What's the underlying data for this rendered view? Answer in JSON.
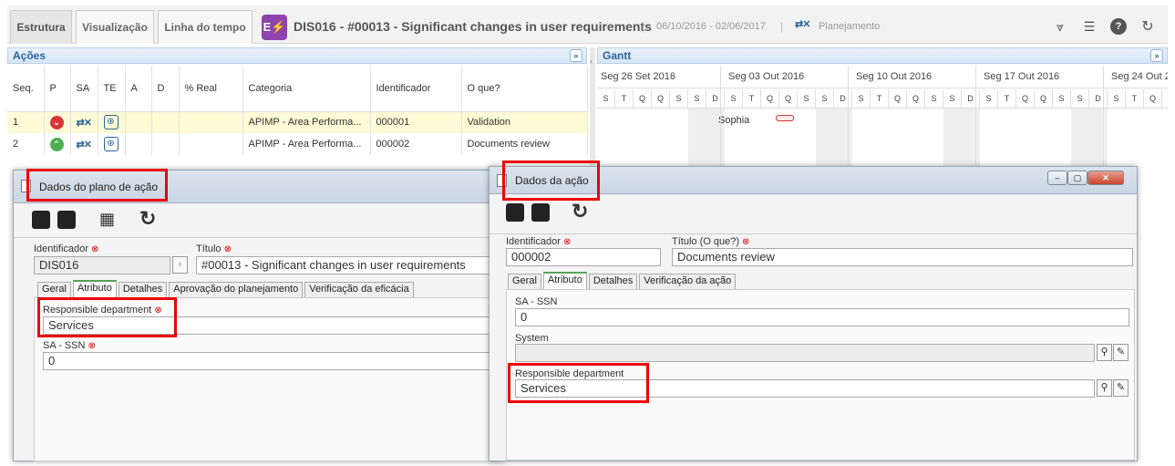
{
  "tabs": [
    {
      "label": "Estrutura"
    },
    {
      "label": "Visualização"
    },
    {
      "label": "Linha do tempo"
    }
  ],
  "header": {
    "title": "DIS016 - #00013 - Significant changes in user requirements",
    "dates": "06/10/2016 - 02/06/2017",
    "status": "Planejamento"
  },
  "actions_panel": {
    "title": "Ações",
    "columns": [
      "Seq.",
      "P",
      "SA",
      "TE",
      "A",
      "D",
      "% Real",
      "Categoria",
      "Identificador",
      "O que?"
    ],
    "rows": [
      {
        "seq": "1",
        "categoria": "APIMP - Area Performa...",
        "identificador": "000001",
        "oque": "Validation",
        "priority": "down",
        "color": "#d9343a"
      },
      {
        "seq": "2",
        "categoria": "APIMP - Area Performa...",
        "identificador": "000002",
        "oque": "Documents review",
        "priority": "up",
        "color": "#4caf50"
      }
    ]
  },
  "gantt": {
    "title": "Gantt",
    "weeks": [
      "Seg 26 Set 2016",
      "Seg 03 Out 2016",
      "Seg 10 Out 2016",
      "Seg 17 Out 2016",
      "Seg 24 Out 2"
    ],
    "days": [
      "S",
      "T",
      "Q",
      "Q",
      "S",
      "S",
      "D"
    ],
    "bar_label": "Sophia"
  },
  "plan_window": {
    "title": "Dados do plano de ação",
    "id_label": "Identificador",
    "id_value": "DIS016",
    "title_label": "Título",
    "title_value": "#00013 - Significant changes in user requirements",
    "tabs": [
      "Geral",
      "Atributo",
      "Detalhes",
      "Aprovação do planejamento",
      "Verificação da eficácia"
    ],
    "dept_label": "Responsible department",
    "dept_value": "Services",
    "ssn_label": "SA - SSN",
    "ssn_value": "0"
  },
  "action_window": {
    "title": "Dados da ação",
    "id_label": "Identificador",
    "id_value": "000002",
    "what_label": "Título (O que?)",
    "what_value": "Documents review",
    "tabs": [
      "Geral",
      "Atributo",
      "Detalhes",
      "Verificação da ação"
    ],
    "ssn_label": "SA - SSN",
    "ssn_value": "0",
    "system_label": "System",
    "system_value": "",
    "dept_label": "Responsible department",
    "dept_value": "Services"
  }
}
